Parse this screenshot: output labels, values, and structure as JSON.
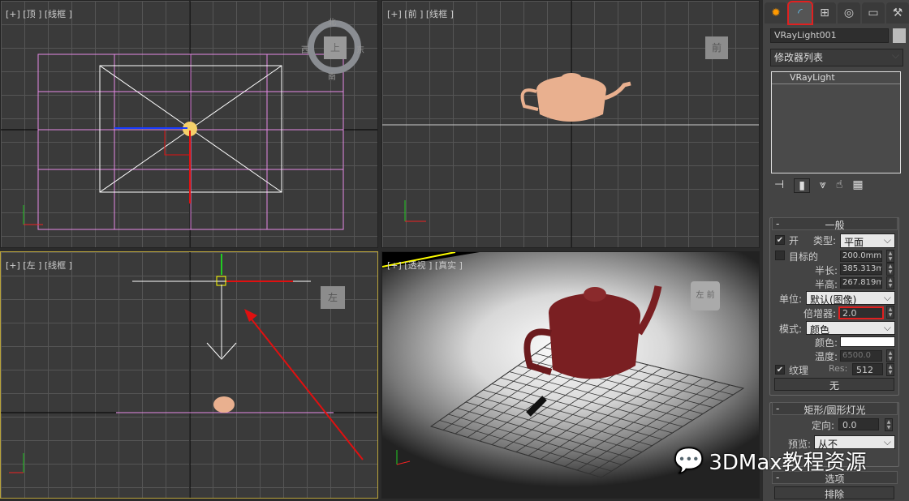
{
  "viewports": {
    "top": {
      "label": "[+]  [顶 ]  [线框 ]",
      "compass": {
        "n": "北",
        "s": "南",
        "e": "东",
        "w": "西",
        "cube": "上"
      }
    },
    "front": {
      "label": "[+]  [前 ]  [线框 ]",
      "cube": "前"
    },
    "left": {
      "label": "[+]  [左 ]  [线框 ]",
      "cube": "左"
    },
    "persp": {
      "label": "[+]  [透视 ]  [真实 ]",
      "cube": "左 前"
    }
  },
  "panel": {
    "tabs": [
      "create",
      "modify",
      "hierarchy",
      "motion",
      "display",
      "utilities"
    ],
    "object_name": "VRayLight001",
    "modifier_list": "修改器列表",
    "stack": [
      "VRayLight"
    ],
    "general": {
      "title": "一般",
      "on_label": "开",
      "on": true,
      "type_label": "类型:",
      "type": "平面",
      "targeted_label": "目标的",
      "targeted": false,
      "target_value": "200.0mm",
      "half_length_label": "半长:",
      "half_length": "385.313m",
      "half_height_label": "半高:",
      "half_height": "267.819m",
      "units_label": "单位:",
      "units": "默认(图像)",
      "multiplier_label": "倍增器:",
      "multiplier": "2.0",
      "mode_label": "模式:",
      "mode": "颜色",
      "color_label": "颜色:",
      "color": "#ffffff",
      "temperature_label": "温度:",
      "temperature": "6500.0",
      "texture_label": "纹理",
      "texture": true,
      "res_label": "Res:",
      "res": "512",
      "none_button": "无"
    },
    "rect": {
      "title": "矩形/圆形灯光",
      "directional_label": "定向:",
      "directional": "0.0",
      "preview_label": "预览:",
      "preview": "从不"
    },
    "options": {
      "title": "选项",
      "exclude_button": "排除"
    }
  },
  "watermark": "3DMax教程资源"
}
